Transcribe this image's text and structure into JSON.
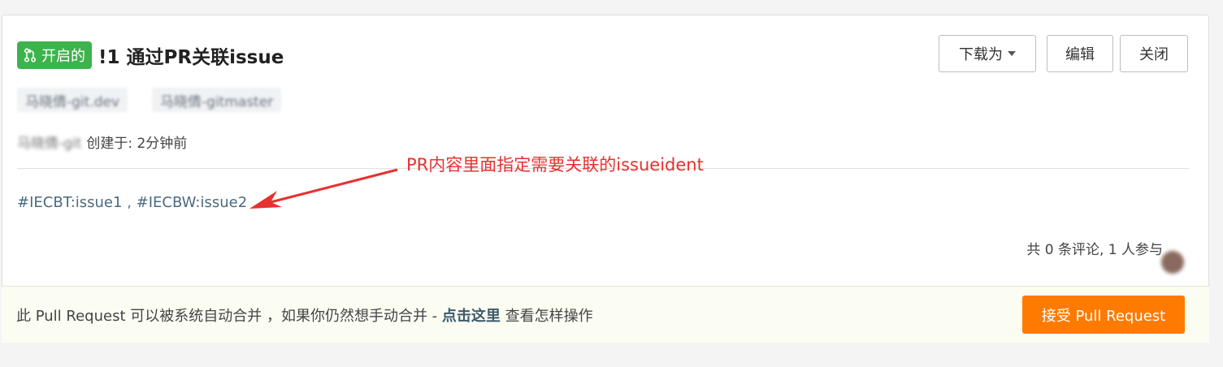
{
  "pr": {
    "status_label": "开启的",
    "title": "!1 通过PR关联issue"
  },
  "actions": {
    "download_label": "下载为",
    "edit_label": "编辑",
    "close_label": "关闭"
  },
  "branches": {
    "source": "马晓倩-git.dev",
    "target": "马晓倩-gitmaster"
  },
  "meta": {
    "author": "马晓倩-git",
    "created_text": "创建于: 2分钟前"
  },
  "annotation": {
    "text": "PR内容里面指定需要关联的issueident"
  },
  "issues": {
    "link1": "#IECBT:issue1",
    "separator": " , ",
    "link2": "#IECBW:issue2"
  },
  "comments": {
    "summary": "共 0 条评论, 1 人参与"
  },
  "merge": {
    "text_before": "此 Pull Request 可以被系统自动合并 ，如果你仍然想手动合并 - ",
    "link_text": "点击这里",
    "text_after": " 查看怎样操作",
    "accept_label": "接受 Pull Request"
  },
  "colors": {
    "status_green": "#3db34c",
    "accept_orange": "#ff7a00",
    "annotation_red": "#e8302f"
  },
  "icons": {
    "status": "pull-request-icon",
    "download_caret": "caret-down-icon"
  }
}
